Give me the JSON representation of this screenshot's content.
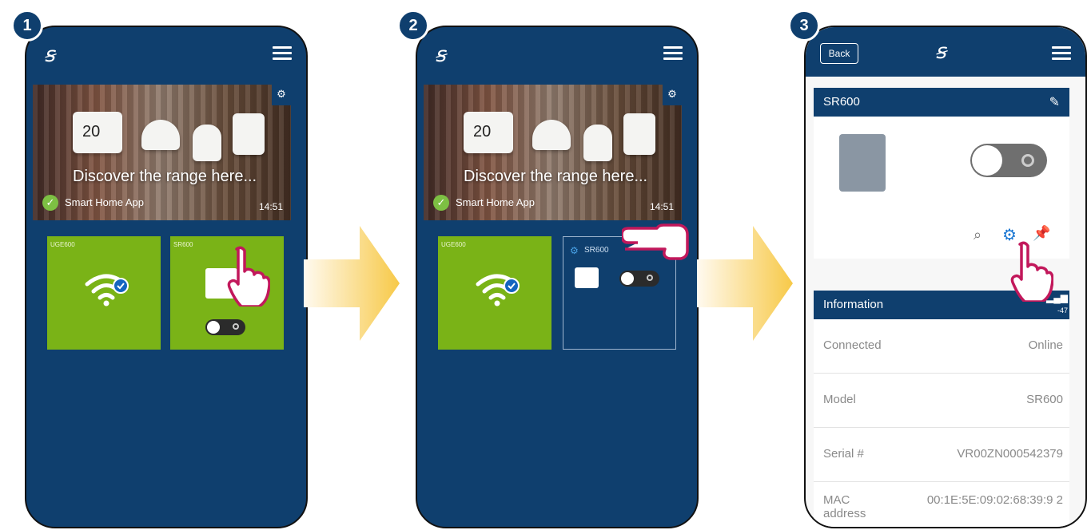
{
  "steps": [
    "1",
    "2",
    "3"
  ],
  "banner": {
    "headline": "Discover the range here...",
    "app_name": "Smart Home App",
    "time": "14:51",
    "thermostat_reading": "20"
  },
  "tiles": {
    "gateway_label": "UGE600",
    "switch_label": "SR600"
  },
  "detail": {
    "back_label": "Back",
    "device_title": "SR600",
    "info_title": "Information",
    "signal_value": "-47",
    "rows": [
      {
        "key": "Connected",
        "value": "Online"
      },
      {
        "key": "Model",
        "value": "SR600"
      },
      {
        "key": "Serial #",
        "value": "VR00ZN000542379"
      },
      {
        "key": "MAC address",
        "value": "00:1E:5E:09:02:68:39:9 2"
      }
    ]
  },
  "colors": {
    "navy": "#0f3f6e",
    "tile_green": "#7ab317",
    "arrow_yellow": "#f7c948",
    "hand_pink": "#c2185b"
  },
  "icons": [
    "logo-icon",
    "menu-icon",
    "gear-icon",
    "wifi-icon",
    "check-icon",
    "switch-icon",
    "search-icon",
    "pin-icon",
    "edit-icon",
    "signal-icon",
    "hand-pointer-icon"
  ]
}
